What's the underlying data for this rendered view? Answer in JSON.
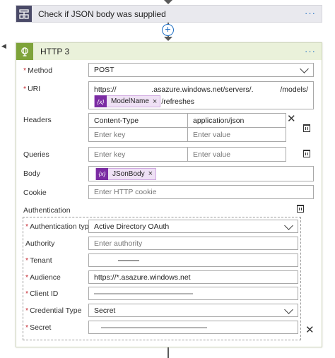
{
  "condition": {
    "title": "Check if JSON body was supplied",
    "menu": "···"
  },
  "connector": {
    "plus": "+"
  },
  "http": {
    "title": "HTTP 3",
    "menu": "···",
    "method": {
      "label": "Method",
      "value": "POST"
    },
    "uri": {
      "label": "URI",
      "prefix": "https://",
      "host": ".asazure.windows.net/servers/.",
      "mid": "/models/",
      "token": {
        "icon": "{x}",
        "name": "ModelName",
        "remove": "×"
      },
      "suffix": "/refreshes"
    },
    "headers": {
      "label": "Headers",
      "rows": [
        {
          "key": "Content-Type",
          "value": "application/json"
        },
        {
          "key_placeholder": "Enter key",
          "value_placeholder": "Enter value"
        }
      ]
    },
    "queries": {
      "label": "Queries",
      "key_placeholder": "Enter key",
      "value_placeholder": "Enter value"
    },
    "body": {
      "label": "Body",
      "token": {
        "icon": "{x}",
        "name": "JSonBody",
        "remove": "×"
      }
    },
    "cookie": {
      "label": "Cookie",
      "placeholder": "Enter HTTP cookie"
    },
    "authentication": {
      "label": "Authentication",
      "type": {
        "label": "Authentication type",
        "value": "Active Directory OAuth"
      },
      "authority": {
        "label": "Authority",
        "placeholder": "Enter authority"
      },
      "tenant": {
        "label": "Tenant"
      },
      "audience": {
        "label": "Audience",
        "value": "https://*.asazure.windows.net"
      },
      "client_id": {
        "label": "Client ID"
      },
      "credential_type": {
        "label": "Credential Type",
        "value": "Secret"
      },
      "secret": {
        "label": "Secret"
      }
    }
  },
  "icons": {
    "condition": "condition-icon",
    "http": "globe-icon",
    "delete": "trash-icon",
    "remove": "close-icon",
    "dropdown": "chevron-down-icon"
  },
  "colors": {
    "accent": "#1f6fc4",
    "http_header": "#eaf1da",
    "http_icon": "#7ea33a",
    "condition_icon": "#4a4a68",
    "token_icon": "#7b2ba3",
    "token_bg": "#efe1f5",
    "required": "#c4262e"
  }
}
